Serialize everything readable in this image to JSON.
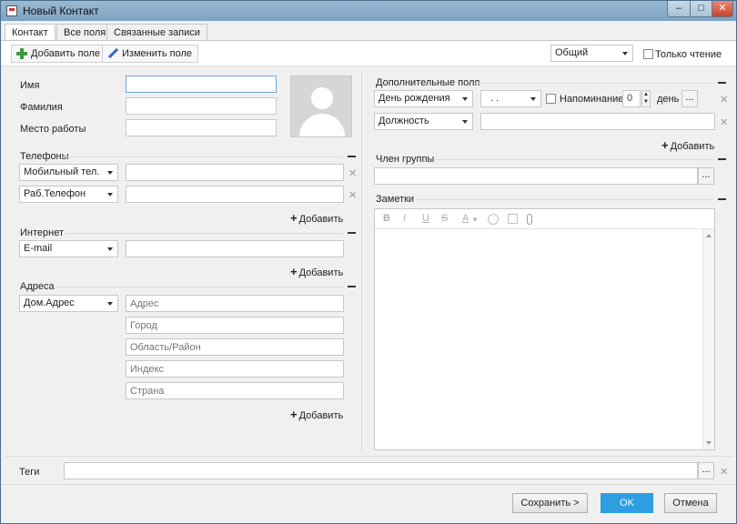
{
  "window": {
    "title": "Новый Контакт",
    "minimize": "–",
    "maximize": "□",
    "close": "✕"
  },
  "tabs": [
    {
      "label": "Контакт"
    },
    {
      "label": "Все поля"
    },
    {
      "label": "Связанные записи"
    }
  ],
  "toolbar": {
    "add_field": "Добавить поле",
    "edit_field": "Изменить поле",
    "category_select": "Общий",
    "readonly_label": "Только чтение"
  },
  "name_section": {
    "first_name_label": "Имя",
    "last_name_label": "Фамилия",
    "workplace_label": "Место работы"
  },
  "phones": {
    "title": "Телефоны",
    "rows": [
      {
        "type": "Мобильный тел."
      },
      {
        "type": "Раб.Телефон"
      }
    ],
    "add": "Добавить"
  },
  "internet": {
    "title": "Интернет",
    "type": "E-mail",
    "add": "Добавить"
  },
  "addresses": {
    "title": "Адреса",
    "type": "Дом.Адрес",
    "fields": [
      "Адрес",
      "Город",
      "Область/Район",
      "Индекс",
      "Страна"
    ],
    "add": "Добавить"
  },
  "extra": {
    "title": "Дополнительные поля",
    "birthday_label": "День рождения",
    "date_value": ". .",
    "reminder_label": "Напоминание",
    "reminder_value": "0",
    "days_label": "день",
    "position_label": "Должность",
    "add": "Добавить",
    "more": "..."
  },
  "group": {
    "title": "Член группы",
    "more": "..."
  },
  "notes": {
    "title": "Заметки",
    "toolbar": [
      "B",
      "I",
      "U",
      "S",
      "A"
    ]
  },
  "tags": {
    "label": "Теги",
    "more": "..."
  },
  "footer": {
    "save_next": "Сохранить >",
    "ok": "OK",
    "cancel": "Отмена"
  },
  "colors": {
    "primary_button": "#2d9fe0",
    "titlebar": "#8fb0cc"
  },
  "icons": {
    "remove": "✕",
    "plus": "+"
  }
}
